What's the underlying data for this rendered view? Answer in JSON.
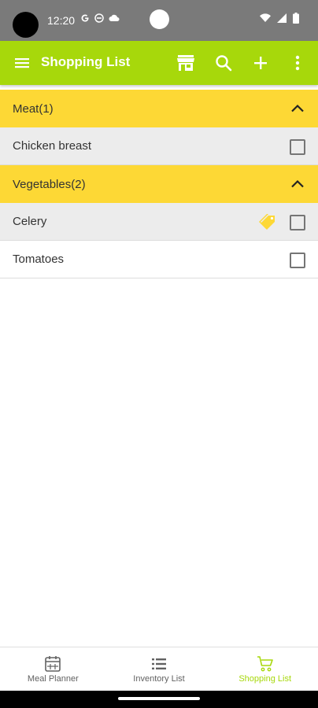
{
  "status_bar": {
    "time": "12:20",
    "left_icons": [
      "google-g-icon",
      "vpn-icon",
      "cloud-icon"
    ],
    "right_icons": [
      "wifi-icon",
      "signal-icon",
      "battery-icon"
    ]
  },
  "app_bar": {
    "title": "Shopping List",
    "background_color": "#a7d80b",
    "actions": [
      "store-icon",
      "search-icon",
      "add-icon",
      "more-vert-icon"
    ]
  },
  "groups": [
    {
      "title": "Meat(1)",
      "expanded": true,
      "items": [
        {
          "label": "Chicken breast",
          "checked": false,
          "tag": false
        }
      ]
    },
    {
      "title": "Vegetables(2)",
      "expanded": true,
      "items": [
        {
          "label": "Celery",
          "checked": false,
          "tag": true
        },
        {
          "label": "Tomatoes",
          "checked": false,
          "tag": false
        }
      ]
    }
  ],
  "colors": {
    "accent": "#a7d80b",
    "group_header": "#fdd835",
    "tag": "#fdd835",
    "shaded_row": "#ececec"
  },
  "bottom_nav": {
    "items": [
      {
        "label": "Meal Planner",
        "icon": "calendar-icon",
        "active": false
      },
      {
        "label": "Inventory List",
        "icon": "list-icon",
        "active": false
      },
      {
        "label": "Shopping List",
        "icon": "cart-icon",
        "active": true
      }
    ]
  }
}
